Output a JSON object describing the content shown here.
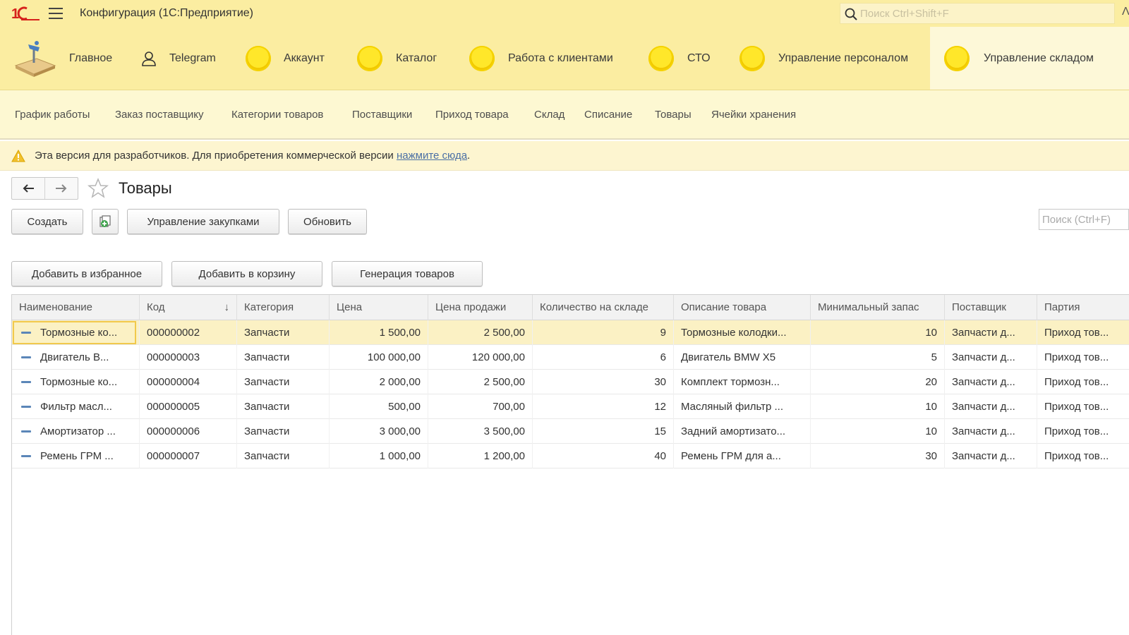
{
  "titlebar": {
    "app_title": "Конфигурация  (1С:Предприятие)",
    "search_placeholder": "Поиск Ctrl+Shift+F"
  },
  "sections": [
    {
      "label": "Главное",
      "icon": "home-desk-icon"
    },
    {
      "label": "Telegram",
      "icon": "person-icon"
    },
    {
      "label": "Аккаунт",
      "icon": "coin-icon"
    },
    {
      "label": "Каталог",
      "icon": "coin-icon"
    },
    {
      "label": "Работа с клиентами",
      "icon": "coin-icon"
    },
    {
      "label": "СТО",
      "icon": "coin-icon"
    },
    {
      "label": "Управление персоналом",
      "icon": "coin-icon"
    },
    {
      "label": "Управление складом",
      "icon": "coin-icon",
      "active": true
    }
  ],
  "functions": [
    "График работы",
    "Заказ поставщику",
    "Категории товаров",
    "Поставщики",
    "Приход товара",
    "Склад",
    "Списание",
    "Товары",
    "Ячейки хранения"
  ],
  "warning": {
    "text": "Эта версия для разработчиков. Для приобретения коммерческой версии ",
    "link": "нажмите сюда",
    "suffix": "."
  },
  "form": {
    "title": "Товары",
    "buttons": {
      "create": "Создать",
      "purchases": "Управление закупками",
      "refresh": "Обновить",
      "add_favorite": "Добавить в избранное",
      "add_cart": "Добавить в корзину",
      "generate": "Генерация товаров"
    },
    "search_placeholder": "Поиск (Ctrl+F)"
  },
  "table": {
    "columns": [
      "Наименование",
      "Код",
      "Категория",
      "Цена",
      "Цена продажи",
      "Количество на складе",
      "Описание товара",
      "Минимальный запас",
      "Поставщик",
      "Партия"
    ],
    "rows": [
      [
        "Тормозные ко...",
        "000000002",
        "Запчасти",
        "1 500,00",
        "2 500,00",
        "9",
        "Тормозные колодки...",
        "10",
        "Запчасти д...",
        "Приход тов..."
      ],
      [
        "Двигатель В...",
        "000000003",
        "Запчасти",
        "100 000,00",
        "120 000,00",
        "6",
        "Двигатель BMW X5",
        "5",
        "Запчасти д...",
        "Приход тов..."
      ],
      [
        "Тормозные ко...",
        "000000004",
        "Запчасти",
        "2 000,00",
        "2 500,00",
        "30",
        "Комплект тормозн...",
        "20",
        "Запчасти д...",
        "Приход тов..."
      ],
      [
        "Фильтр масл...",
        "000000005",
        "Запчасти",
        "500,00",
        "700,00",
        "12",
        "Масляный фильтр ...",
        "10",
        "Запчасти д...",
        "Приход тов..."
      ],
      [
        "Амортизатор ...",
        "000000006",
        "Запчасти",
        "3 000,00",
        "3 500,00",
        "15",
        "Задний амортизато...",
        "10",
        "Запчасти д...",
        "Приход тов..."
      ],
      [
        "Ремень ГРМ ...",
        "000000007",
        "Запчасти",
        "1 000,00",
        "1 200,00",
        "40",
        "Ремень ГРМ для а...",
        "30",
        "Запчасти д...",
        "Приход тов..."
      ]
    ],
    "sort_indicator": "↓",
    "selected_row": 0
  },
  "colors": {
    "header_bg": "#fbeda1",
    "functions_bg": "#fdf8d2",
    "selected_row": "#fbf1c4",
    "link": "#4a6fa5"
  }
}
